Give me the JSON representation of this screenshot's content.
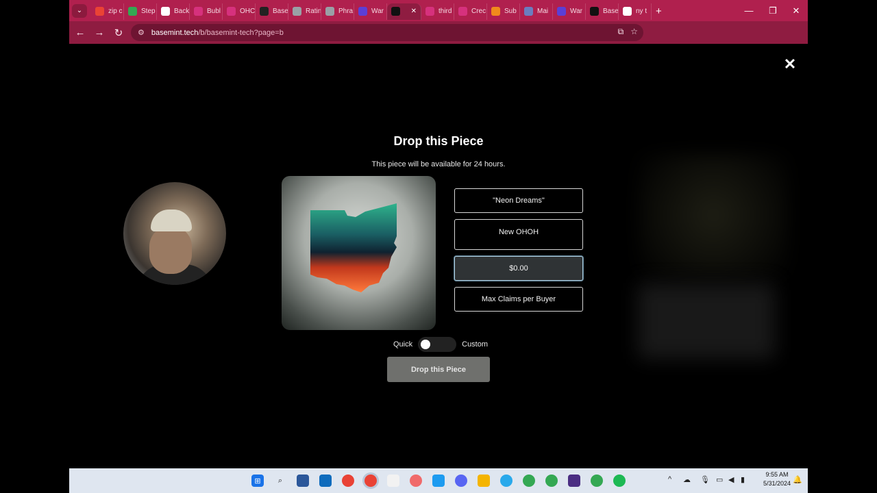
{
  "browser": {
    "tabs": [
      {
        "label": "zip c",
        "fav": "#ea4335"
      },
      {
        "label": "Step",
        "fav": "#34a853"
      },
      {
        "label": "Back",
        "fav": "#ffffff"
      },
      {
        "label": "Bubl",
        "fav": "#d6317d"
      },
      {
        "label": "OHC",
        "fav": "#d6317d"
      },
      {
        "label": "Base",
        "fav": "#222222"
      },
      {
        "label": "Ratin",
        "fav": "#9aa0a6"
      },
      {
        "label": "Phra",
        "fav": "#9aa0a6"
      },
      {
        "label": "War",
        "fav": "#5b3fd6"
      },
      {
        "label": "",
        "fav": "#111111",
        "active": true
      },
      {
        "label": "third",
        "fav": "#d6317d"
      },
      {
        "label": "Crec",
        "fav": "#d6317d"
      },
      {
        "label": "Sub",
        "fav": "#f08a1c"
      },
      {
        "label": "Mai",
        "fav": "#6b7dbf"
      },
      {
        "label": "War",
        "fav": "#5b3fd6"
      },
      {
        "label": "Base",
        "fav": "#111111"
      },
      {
        "label": "ny t",
        "fav": "#ffffff"
      }
    ],
    "url_host": "basemint.tech",
    "url_path": "/b/basemint-tech?page=b",
    "accent": "#b0204e"
  },
  "modal": {
    "close_label": "✕",
    "title": "Drop this Piece",
    "subtitle": "This piece will be available for 24 hours.",
    "fields": {
      "name_value": "\"Neon Dreams\"",
      "description_value": "New OHOH",
      "price_value": "$0.00",
      "max_claims_placeholder": "Max Claims per Buyer"
    },
    "toggle_left": "Quick",
    "toggle_right": "Custom",
    "submit_label": "Drop this Piece"
  },
  "taskbar": {
    "time": "9:55 AM",
    "date": "5/31/2024"
  }
}
